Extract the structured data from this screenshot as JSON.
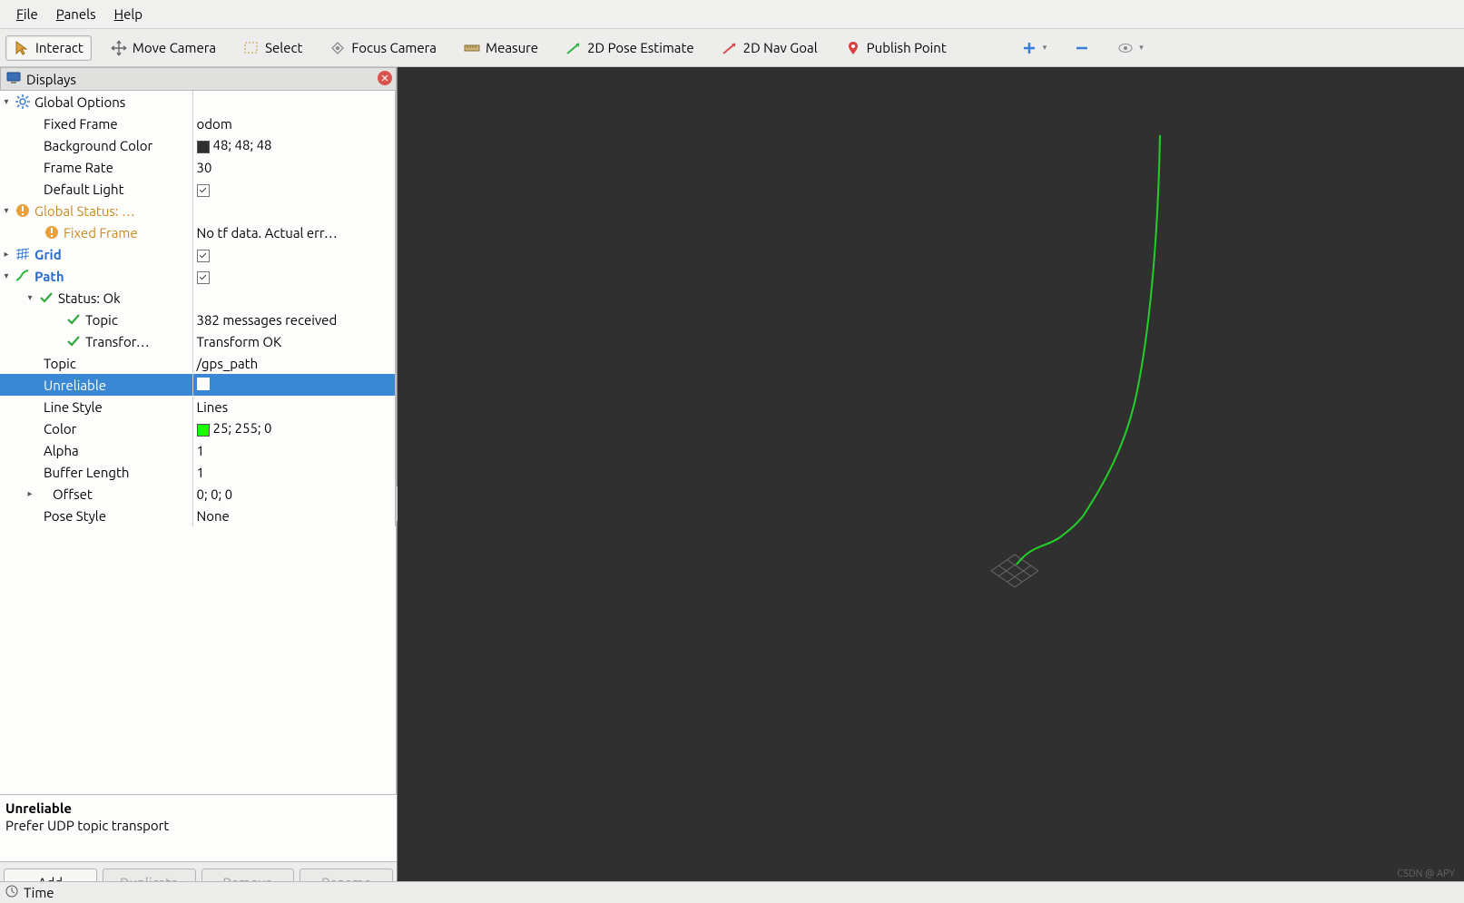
{
  "menu": {
    "file": "File",
    "panels": "Panels",
    "help": "Help"
  },
  "toolbar": {
    "interact": "Interact",
    "move_camera": "Move Camera",
    "select": "Select",
    "focus_camera": "Focus Camera",
    "measure": "Measure",
    "pose_estimate": "2D Pose Estimate",
    "nav_goal": "2D Nav Goal",
    "publish_point": "Publish Point"
  },
  "panel": {
    "title": "Displays"
  },
  "tree": {
    "global_options": "Global Options",
    "fixed_frame": "Fixed Frame",
    "fixed_frame_v": "odom",
    "bg_color": "Background Color",
    "bg_color_v": "48; 48; 48",
    "frame_rate": "Frame Rate",
    "frame_rate_v": "30",
    "default_light": "Default Light",
    "global_status": "Global Status: …",
    "gs_fixed_frame": "Fixed Frame",
    "gs_fixed_frame_v": "No tf data.  Actual err…",
    "grid": "Grid",
    "path": "Path",
    "status_ok": "Status: Ok",
    "topic_status": "Topic",
    "topic_status_v": "382 messages received",
    "transform": "Transfor…",
    "transform_v": "Transform OK",
    "topic": "Topic",
    "topic_v": "/gps_path",
    "unreliable": "Unreliable",
    "line_style": "Line Style",
    "line_style_v": "Lines",
    "color": "Color",
    "color_v": "25; 255; 0",
    "alpha": "Alpha",
    "alpha_v": "1",
    "buffer_length": "Buffer Length",
    "buffer_length_v": "1",
    "offset": "Offset",
    "offset_v": "0; 0; 0",
    "pose_style": "Pose Style",
    "pose_style_v": "None"
  },
  "desc": {
    "title": "Unreliable",
    "body": "Prefer UDP topic transport"
  },
  "buttons": {
    "add": "Add",
    "dup": "Duplicate",
    "rem": "Remove",
    "ren": "Rename"
  },
  "bottom": {
    "time": "Time"
  },
  "watermark": "CSDN @ APY",
  "colors": {
    "bg_chip": "#303030",
    "path_chip": "#19ff00",
    "path_stroke": "#22d028"
  }
}
